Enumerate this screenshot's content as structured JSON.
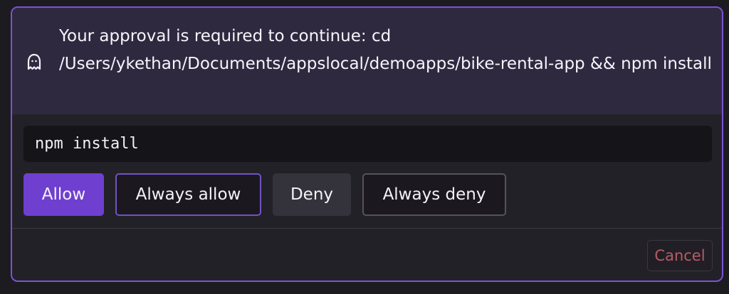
{
  "approval_dialog": {
    "message": "Your approval is required to continue: cd /Users/yketh﻿an/Documents/appslocal/demoapps/bike-rental-app && npm install",
    "command": "npm install",
    "buttons": {
      "allow": "Allow",
      "always_allow": "Always allow",
      "deny": "Deny",
      "always_deny": "Always deny",
      "cancel": "Cancel"
    },
    "icons": {
      "status": "ghost-icon"
    },
    "colors": {
      "accent": "#6f3fd0",
      "accent_border": "#7b53d6",
      "header_background": "#2f2940",
      "panel_background": "#232128",
      "cancel_text": "#b75b66"
    }
  }
}
